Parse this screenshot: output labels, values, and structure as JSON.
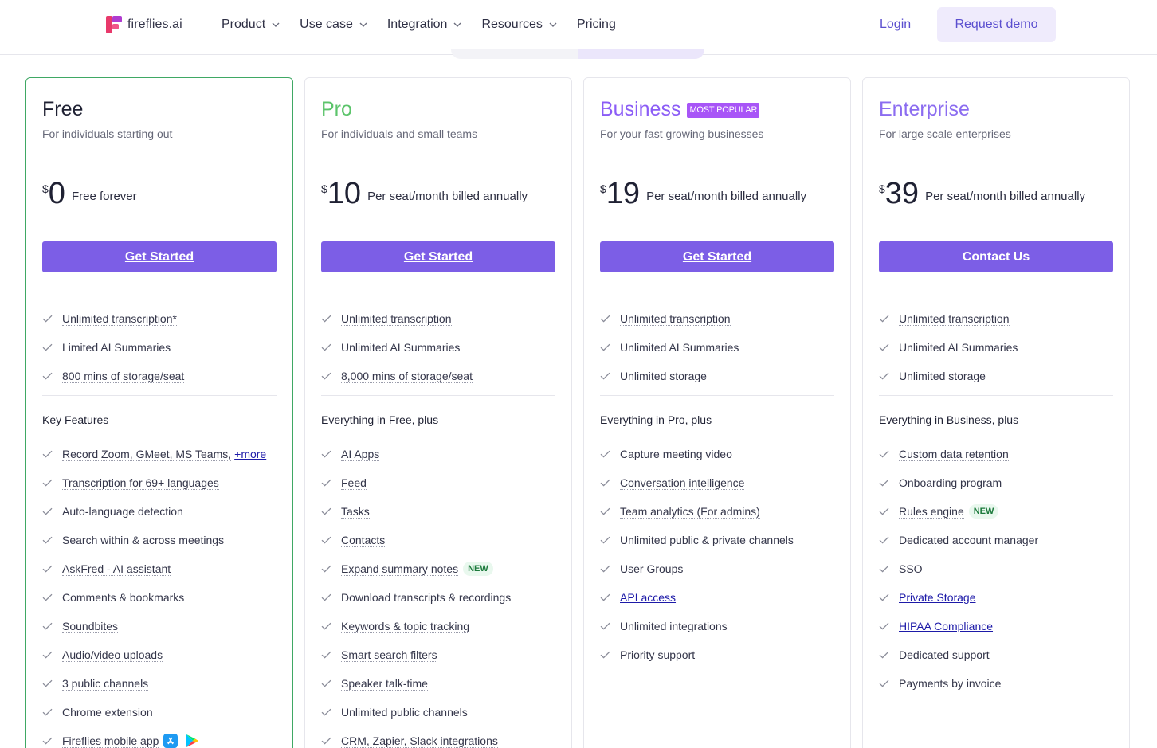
{
  "nav": {
    "brand": "fireflies.ai",
    "items": [
      {
        "label": "Product",
        "dropdown": true
      },
      {
        "label": "Use case",
        "dropdown": true
      },
      {
        "label": "Integration",
        "dropdown": true
      },
      {
        "label": "Resources",
        "dropdown": true
      },
      {
        "label": "Pricing",
        "dropdown": false
      }
    ],
    "login": "Login",
    "demo": "Request demo"
  },
  "colors": {
    "accent": "#7c5ee6",
    "free": "#1f2133",
    "pro": "#5cc46b",
    "business": "#8b5cf6",
    "enterprise": "#8b6cf0",
    "badge": "#a855f7",
    "link": "#1d1aa8"
  },
  "plans": [
    {
      "name": "Free",
      "subtitle": "For individuals starting out",
      "currency": "$",
      "price": "0",
      "price_note": "Free forever",
      "cta": "Get Started",
      "basic": [
        {
          "text": "Unlimited transcription*",
          "dotted": true
        },
        {
          "text": "Limited AI Summaries",
          "dotted": true
        },
        {
          "text": "800 mins of storage/seat",
          "dotted": true
        }
      ],
      "section_title": "Key Features",
      "features": [
        {
          "text": "Record Zoom, GMeet, MS Teams,",
          "dotted": true,
          "more": "+more"
        },
        {
          "text": "Transcription for 69+ languages",
          "dotted": true
        },
        {
          "text": "Auto-language detection",
          "dotted": false
        },
        {
          "text": "Search within & across meetings",
          "dotted": false
        },
        {
          "text": "AskFred - AI assistant",
          "dotted": true
        },
        {
          "text": "Comments & bookmarks",
          "dotted": false
        },
        {
          "text": "Soundbites",
          "dotted": true
        },
        {
          "text": "Audio/video uploads",
          "dotted": true
        },
        {
          "text": "3 public channels",
          "dotted": true
        },
        {
          "text": "Chrome extension",
          "dotted": false
        },
        {
          "text": "Fireflies mobile app",
          "dotted": true,
          "stores": true
        }
      ]
    },
    {
      "name": "Pro",
      "subtitle": "For individuals and small teams",
      "currency": "$",
      "price": "10",
      "price_note": "Per seat/month billed annually",
      "cta": "Get Started",
      "basic": [
        {
          "text": "Unlimited transcription",
          "dotted": true
        },
        {
          "text": "Unlimited AI Summaries",
          "dotted": true
        },
        {
          "text": "8,000 mins of storage/seat",
          "dotted": true
        }
      ],
      "section_title": "Everything in Free, plus",
      "features": [
        {
          "text": "AI Apps",
          "dotted": true
        },
        {
          "text": "Feed",
          "dotted": true
        },
        {
          "text": "Tasks",
          "dotted": true
        },
        {
          "text": "Contacts",
          "dotted": true
        },
        {
          "text": "Expand summary notes",
          "dotted": true,
          "badge": "NEW"
        },
        {
          "text": "Download transcripts & recordings",
          "dotted": false
        },
        {
          "text": "Keywords & topic tracking",
          "dotted": true
        },
        {
          "text": "Smart search filters",
          "dotted": true
        },
        {
          "text": "Speaker talk-time",
          "dotted": true
        },
        {
          "text": "Unlimited public channels",
          "dotted": false
        },
        {
          "text": "CRM, Zapier, Slack integrations",
          "dotted": true
        }
      ]
    },
    {
      "name": "Business",
      "badge": "MOST POPULAR",
      "subtitle": "For your fast growing businesses",
      "currency": "$",
      "price": "19",
      "price_note": "Per seat/month billed annually",
      "cta": "Get Started",
      "basic": [
        {
          "text": "Unlimited transcription",
          "dotted": true
        },
        {
          "text": "Unlimited AI Summaries",
          "dotted": true
        },
        {
          "text": "Unlimited storage",
          "dotted": false
        }
      ],
      "section_title": "Everything in Pro, plus",
      "features": [
        {
          "text": "Capture meeting video",
          "dotted": false
        },
        {
          "text": "Conversation intelligence",
          "dotted": true
        },
        {
          "text": "Team analytics (For admins)",
          "dotted": true
        },
        {
          "text": "Unlimited public & private channels",
          "dotted": false
        },
        {
          "text": "User Groups",
          "dotted": false
        },
        {
          "text": "API access",
          "dotted": false,
          "link": true
        },
        {
          "text": "Unlimited integrations",
          "dotted": false
        },
        {
          "text": "Priority support",
          "dotted": false
        }
      ]
    },
    {
      "name": "Enterprise",
      "subtitle": "For large scale enterprises",
      "currency": "$",
      "price": "39",
      "price_note": "Per seat/month billed annually",
      "cta": "Contact Us",
      "basic": [
        {
          "text": "Unlimited transcription",
          "dotted": true
        },
        {
          "text": "Unlimited AI Summaries",
          "dotted": true
        },
        {
          "text": "Unlimited storage",
          "dotted": false
        }
      ],
      "section_title": "Everything in Business, plus",
      "features": [
        {
          "text": "Custom data retention",
          "dotted": true
        },
        {
          "text": "Onboarding program",
          "dotted": false
        },
        {
          "text": "Rules engine",
          "dotted": true,
          "badge": "NEW"
        },
        {
          "text": "Dedicated account manager",
          "dotted": false
        },
        {
          "text": "SSO",
          "dotted": false
        },
        {
          "text": "Private Storage",
          "dotted": false,
          "link": true
        },
        {
          "text": "HIPAA Compliance",
          "dotted": false,
          "link": true
        },
        {
          "text": "Dedicated support",
          "dotted": false
        },
        {
          "text": "Payments by invoice",
          "dotted": false
        }
      ]
    }
  ]
}
